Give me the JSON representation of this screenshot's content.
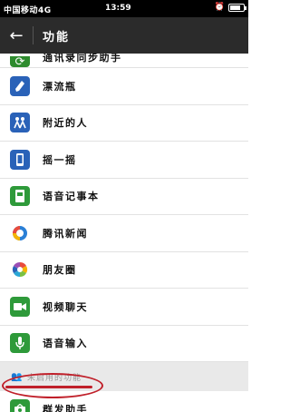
{
  "status": {
    "carrier": "中国移动4G",
    "time": "13:59"
  },
  "header": {
    "title": "功能"
  },
  "list": {
    "items": [
      {
        "label": "通讯录同步助手",
        "icon": "sync-icon",
        "color": "#2e8b2e"
      },
      {
        "label": "漂流瓶",
        "icon": "bottle-icon",
        "color": "#2a62b8"
      },
      {
        "label": "附近的人",
        "icon": "people-nearby-icon",
        "color": "#2a62b8"
      },
      {
        "label": "摇一摇",
        "icon": "shake-phone-icon",
        "color": "#2a62b8"
      },
      {
        "label": "语音记事本",
        "icon": "voice-note-icon",
        "color": "#2e9a3a"
      },
      {
        "label": "腾讯新闻",
        "icon": "tencent-news-icon",
        "color": "#2a62b8"
      },
      {
        "label": "朋友圈",
        "icon": "moments-icon",
        "color": "#ffffff"
      },
      {
        "label": "视频聊天",
        "icon": "video-chat-icon",
        "color": "#2e9a3a"
      },
      {
        "label": "语音输入",
        "icon": "microphone-icon",
        "color": "#2e9a3a"
      }
    ]
  },
  "section": {
    "unused_label": "未启用的功能"
  },
  "unused": {
    "items": [
      {
        "label": "群发助手",
        "icon": "broadcast-icon",
        "color": "#2e9a3a"
      }
    ]
  }
}
